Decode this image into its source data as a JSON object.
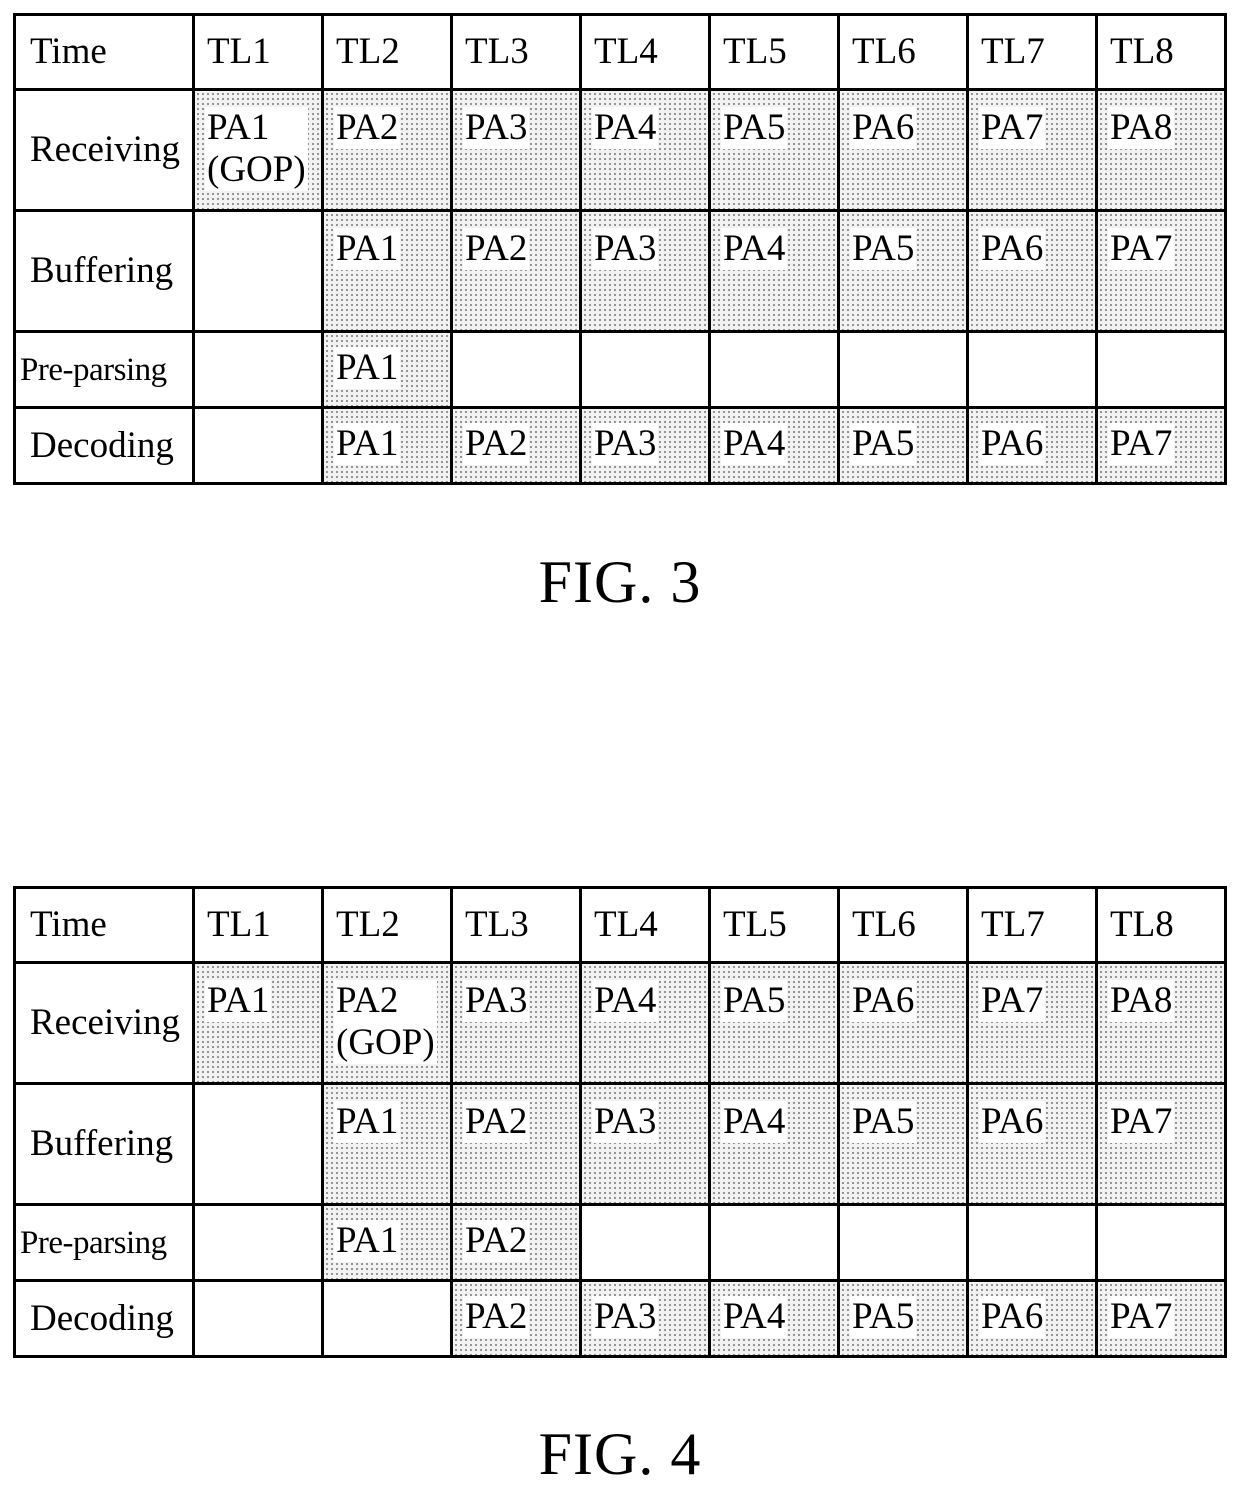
{
  "figures": [
    {
      "caption": "FIG. 3",
      "header": [
        "Time",
        "TL1",
        "TL2",
        "TL3",
        "TL4",
        "TL5",
        "TL6",
        "TL7",
        "TL8"
      ],
      "rows": [
        {
          "label": "Receiving",
          "cells": [
            {
              "text": "PA1\n(GOP)",
              "shaded": true
            },
            {
              "text": "PA2",
              "shaded": true
            },
            {
              "text": "PA3",
              "shaded": true
            },
            {
              "text": "PA4",
              "shaded": true
            },
            {
              "text": "PA5",
              "shaded": true
            },
            {
              "text": "PA6",
              "shaded": true
            },
            {
              "text": "PA7",
              "shaded": true
            },
            {
              "text": "PA8",
              "shaded": true
            }
          ]
        },
        {
          "label": "Buffering",
          "cells": [
            {
              "text": "",
              "shaded": false
            },
            {
              "text": "PA1",
              "shaded": true
            },
            {
              "text": "PA2",
              "shaded": true
            },
            {
              "text": "PA3",
              "shaded": true
            },
            {
              "text": "PA4",
              "shaded": true
            },
            {
              "text": "PA5",
              "shaded": true
            },
            {
              "text": "PA6",
              "shaded": true
            },
            {
              "text": "PA7",
              "shaded": true
            }
          ]
        },
        {
          "label": "Pre-parsing",
          "cells": [
            {
              "text": "",
              "shaded": false
            },
            {
              "text": "PA1",
              "shaded": true
            },
            {
              "text": "",
              "shaded": false
            },
            {
              "text": "",
              "shaded": false
            },
            {
              "text": "",
              "shaded": false
            },
            {
              "text": "",
              "shaded": false
            },
            {
              "text": "",
              "shaded": false
            },
            {
              "text": "",
              "shaded": false
            }
          ]
        },
        {
          "label": "Decoding",
          "cells": [
            {
              "text": "",
              "shaded": false
            },
            {
              "text": "PA1",
              "shaded": true
            },
            {
              "text": "PA2",
              "shaded": true
            },
            {
              "text": "PA3",
              "shaded": true
            },
            {
              "text": "PA4",
              "shaded": true
            },
            {
              "text": "PA5",
              "shaded": true
            },
            {
              "text": "PA6",
              "shaded": true
            },
            {
              "text": "PA7",
              "shaded": true
            }
          ]
        }
      ]
    },
    {
      "caption": "FIG. 4",
      "header": [
        "Time",
        "TL1",
        "TL2",
        "TL3",
        "TL4",
        "TL5",
        "TL6",
        "TL7",
        "TL8"
      ],
      "rows": [
        {
          "label": "Receiving",
          "cells": [
            {
              "text": "PA1",
              "shaded": true
            },
            {
              "text": "PA2\n(GOP)",
              "shaded": true
            },
            {
              "text": "PA3",
              "shaded": true
            },
            {
              "text": "PA4",
              "shaded": true
            },
            {
              "text": "PA5",
              "shaded": true
            },
            {
              "text": "PA6",
              "shaded": true
            },
            {
              "text": "PA7",
              "shaded": true
            },
            {
              "text": "PA8",
              "shaded": true
            }
          ]
        },
        {
          "label": "Buffering",
          "cells": [
            {
              "text": "",
              "shaded": false
            },
            {
              "text": "PA1",
              "shaded": true
            },
            {
              "text": "PA2",
              "shaded": true
            },
            {
              "text": "PA3",
              "shaded": true
            },
            {
              "text": "PA4",
              "shaded": true
            },
            {
              "text": "PA5",
              "shaded": true
            },
            {
              "text": "PA6",
              "shaded": true
            },
            {
              "text": "PA7",
              "shaded": true
            }
          ]
        },
        {
          "label": "Pre-parsing",
          "cells": [
            {
              "text": "",
              "shaded": false
            },
            {
              "text": "PA1",
              "shaded": true
            },
            {
              "text": "PA2",
              "shaded": true
            },
            {
              "text": "",
              "shaded": false
            },
            {
              "text": "",
              "shaded": false
            },
            {
              "text": "",
              "shaded": false
            },
            {
              "text": "",
              "shaded": false
            },
            {
              "text": "",
              "shaded": false
            }
          ]
        },
        {
          "label": "Decoding",
          "cells": [
            {
              "text": "",
              "shaded": false
            },
            {
              "text": "",
              "shaded": false
            },
            {
              "text": "PA2",
              "shaded": true
            },
            {
              "text": "PA3",
              "shaded": true
            },
            {
              "text": "PA4",
              "shaded": true
            },
            {
              "text": "PA5",
              "shaded": true
            },
            {
              "text": "PA6",
              "shaded": true
            },
            {
              "text": "PA7",
              "shaded": true
            }
          ]
        }
      ]
    }
  ]
}
